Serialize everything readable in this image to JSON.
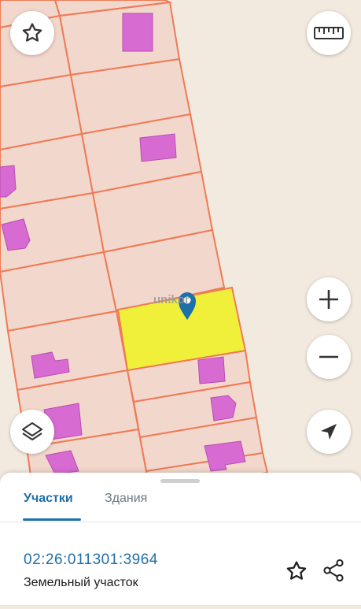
{
  "map": {
    "watermark_text": "unikor",
    "colors": {
      "background": "#f3eadf",
      "parcel_fill": "#f2d7cc",
      "parcel_border": "#f07a55",
      "building": "#d86bd2",
      "selected_parcel": "#f0f03a",
      "marker": "#1f6fa8"
    }
  },
  "controls": {
    "favorite_icon": "star-icon",
    "ruler_icon": "ruler-icon",
    "zoom_in_icon": "plus-icon",
    "zoom_out_icon": "minus-icon",
    "layers_icon": "layers-icon",
    "location_icon": "navigation-arrow-icon"
  },
  "sheet": {
    "tabs": [
      {
        "label": "Участки",
        "active": true
      },
      {
        "label": "Здания",
        "active": false
      }
    ],
    "cadastral_number": "02:26:011301:3964",
    "object_type": "Земельный участок",
    "star_icon": "star-outline-icon",
    "share_icon": "share-icon"
  }
}
